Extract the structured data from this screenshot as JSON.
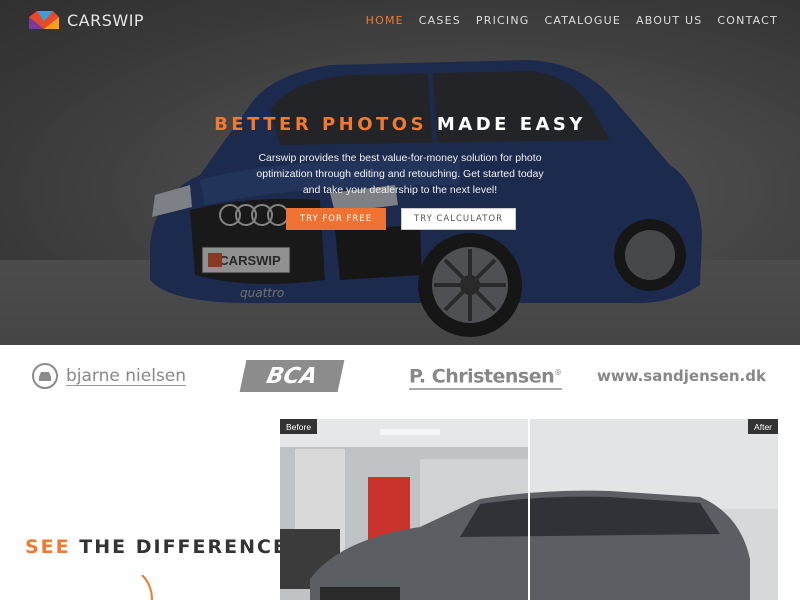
{
  "brand": {
    "name": "CARSWIP"
  },
  "nav": {
    "items": [
      {
        "label": "HOME",
        "active": true
      },
      {
        "label": "CASES",
        "active": false
      },
      {
        "label": "PRICING",
        "active": false
      },
      {
        "label": "CATALOGUE",
        "active": false
      },
      {
        "label": "ABOUT US",
        "active": false
      },
      {
        "label": "CONTACT",
        "active": false
      }
    ]
  },
  "hero": {
    "headline_accent": "BETTER PHOTOS",
    "headline_rest": " MADE EASY",
    "description": "Carswip provides the best value-for-money solution for photo optimization through editing and retouching. Get started today and take your dealership to the next level!",
    "primary_button": "TRY FOR FREE",
    "secondary_button": "TRY CALCULATOR",
    "plate_text": "CARSWIP",
    "grille_text": "quattro"
  },
  "partners": {
    "bjarne": "bjarne nielsen",
    "bca": "BCA",
    "christensen": "P. Christensen",
    "christensen_mark": "®",
    "sandjensen": "www.sandjensen.dk"
  },
  "difference": {
    "accent": "SEE",
    "rest": " THE DIFFERENCE",
    "before_label": "Before",
    "after_label": "After"
  },
  "colors": {
    "accent": "#f07a32",
    "nav_text": "#dedede",
    "logo_gray": "#8c8c8c"
  }
}
